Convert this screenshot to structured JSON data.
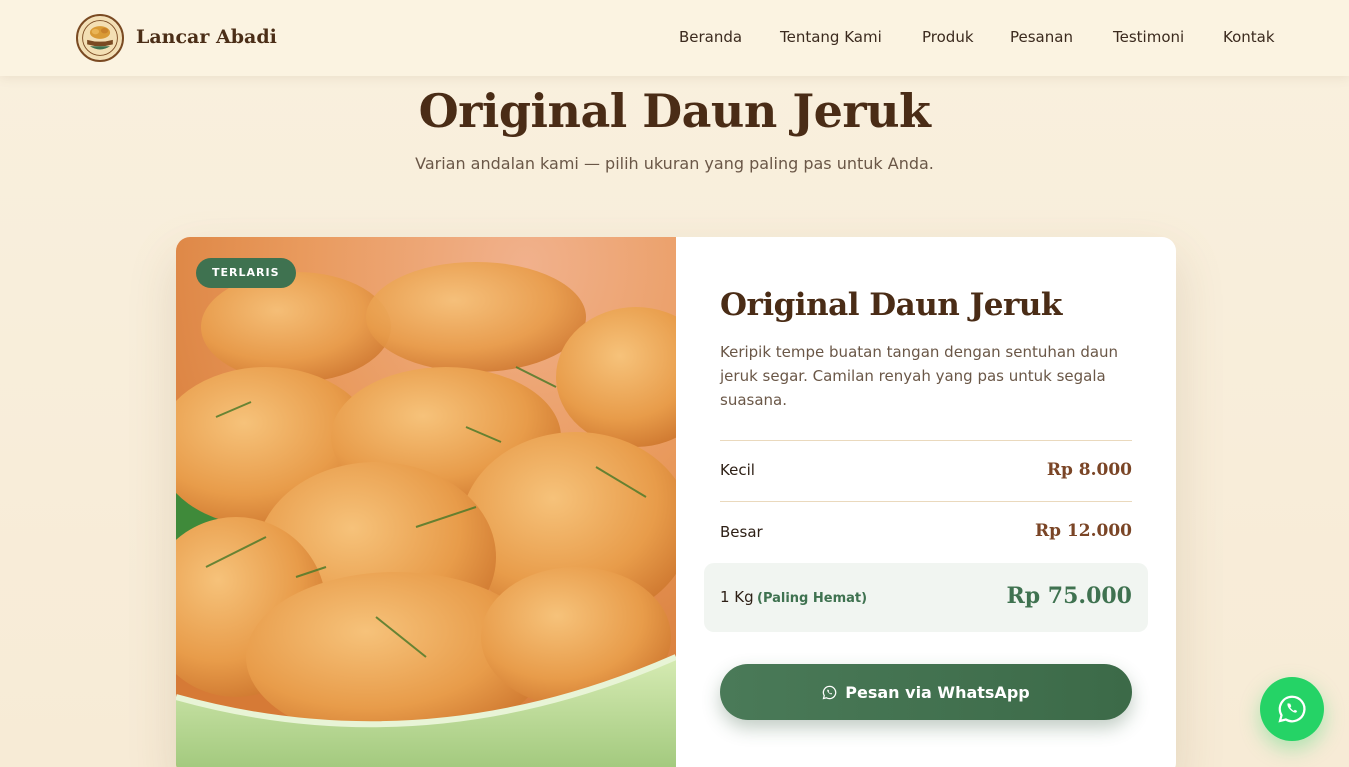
{
  "header": {
    "brand": "Lancar Abadi",
    "logo_text": "LANCAR ABADI",
    "nav": [
      "Beranda",
      "Tentang Kami",
      "Produk",
      "Pesanan",
      "Testimoni",
      "Kontak"
    ]
  },
  "hero": {
    "title": "Original Daun Jeruk",
    "subtitle": "Varian andalan kami — pilih ukuran yang paling pas untuk Anda."
  },
  "product": {
    "badge": "TERLARIS",
    "title": "Original Daun Jeruk",
    "description": "Keripik tempe buatan tangan dengan sentuhan daun jeruk segar. Camilan renyah yang pas untuk segala suasana.",
    "sizes": [
      {
        "label": "Kecil",
        "price": "Rp 8.000"
      },
      {
        "label": "Besar",
        "price": "Rp 12.000"
      },
      {
        "label": "1 Kg",
        "tag": "(Paling Hemat)",
        "price": "Rp 75.000"
      }
    ],
    "button_label": "Pesan via WhatsApp"
  },
  "icons": {
    "whatsapp_button": "whatsapp-icon",
    "floating": "whatsapp-icon"
  },
  "colors": {
    "brand_brown": "#4a2c16",
    "accent_green": "#3f7250",
    "whatsapp_green": "#25d366",
    "background": "#f9f0de"
  }
}
